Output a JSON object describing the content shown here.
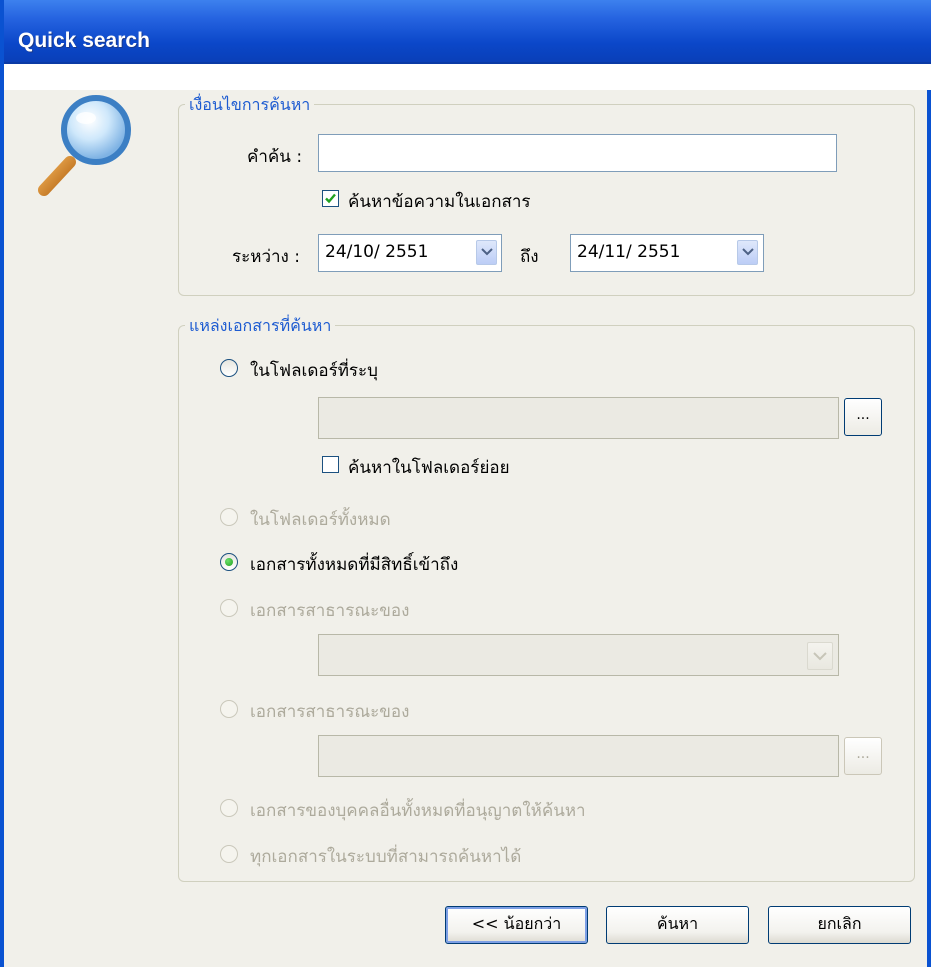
{
  "window": {
    "title": "Quick search"
  },
  "conditions": {
    "legend": "เงื่อนไขการค้นหา",
    "keyword_label": "คำค้น :",
    "keyword_value": "",
    "search_text_label": "ค้นหาข้อความในเอกสาร",
    "search_text_checked": true,
    "between_label": "ระหว่าง :",
    "date_from": "24/10/ 2551",
    "to_label": "ถึง",
    "date_to": "24/11/ 2551"
  },
  "sources": {
    "legend": "แหล่งเอกสารที่ค้นหา",
    "opt_specified_folder": "ในโฟลเดอร์ที่ระบุ",
    "folder_path": "",
    "browse_label": "...",
    "subfolders_label": "ค้นหาในโฟลเดอร์ย่อย",
    "subfolders_checked": false,
    "opt_all_folders": "ในโฟลเดอร์ทั้งหมด",
    "opt_all_accessible": "เอกสารทั้งหมดที่มีสิทธิ์เข้าถึง",
    "opt_public_1": "เอกสารสาธารณะของ",
    "public_select_value": "",
    "opt_public_2": "เอกสารสาธารณะของ",
    "public_path": "",
    "browse2_label": "...",
    "opt_others": "เอกสารของบุคคลอื่นทั้งหมดที่อนุญาตให้ค้นหา",
    "opt_all_system": "ทุกเอกสารในระบบที่สามารถค้นหาได้",
    "selected_option": "opt_all_accessible"
  },
  "footer": {
    "less_label": "<< น้อยกว่า",
    "search_label": "ค้นหา",
    "cancel_label": "ยกเลิก"
  }
}
